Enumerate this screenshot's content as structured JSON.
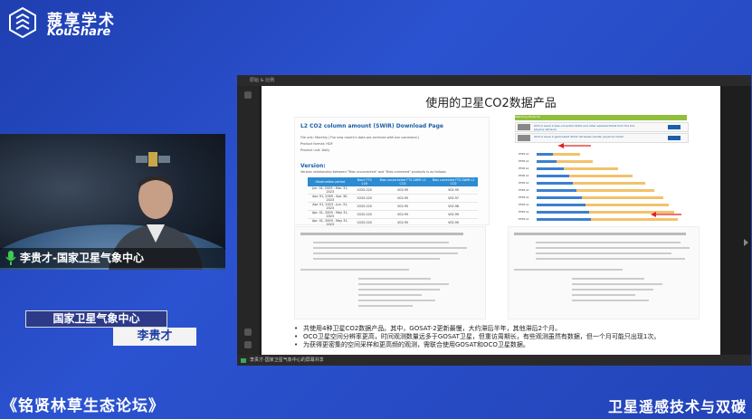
{
  "brand": {
    "name_cn": "蔻享学术",
    "name_en": "KouShare"
  },
  "speaker": {
    "caption": "李贵才-国家卫星气象中心",
    "org": "国家卫星气象中心",
    "name": "李贵才"
  },
  "screen_share": {
    "topbar": "原始 & 比例",
    "bottombar": "李贵才-国家卫星气象中心的屏幕共享"
  },
  "slide": {
    "title": "使用的卫星CO2数据产品",
    "panel_left": {
      "title": "L2 CO2 column amount (SWIR) Download Page",
      "lines": [
        "File unit: Monthly (The new month's data are archived with bar command.)",
        "Product format: HDF",
        "Product unit: Daily"
      ],
      "version_label": "Version:",
      "version_note": "Version relationship between \"Bias uncorrected\" and \"Bias corrected\" products is as follows.",
      "table": {
        "headers": [
          "Observation period",
          "Band TTS L1B",
          "Bias uncorrected FTS-SWIR L2 CO2",
          "Bias corrected FTS-SWIR L2 CO2"
        ],
        "rows": [
          [
            "Jun. 01, 2009 - Mar. 31, 2023",
            "V220.220",
            "V02.95",
            "V02.95"
          ],
          [
            "Apr. 01, 2009 - Apr. 30, 2023",
            "V220.220",
            "V02.95",
            "V02.97"
          ],
          [
            "Apr. 01, 2023 - Jun. 31, 2023",
            "V220.220",
            "V02.95",
            "V02.98"
          ],
          [
            "Apr. 01, 2009 - May 31, 2023",
            "V220.220",
            "V02.95",
            "V02.99"
          ],
          [
            "Apr. 01, 2009 - May 31, 2023",
            "V220.220",
            "V02.95",
            "V02.90"
          ]
        ]
      }
    },
    "panel_right": {
      "header": "Matching Products",
      "rows": [
        "OCO-2 Level 2 bias-corrected XCO2 and other selected fields from the full-physics retrieval",
        "OCO-2 Level 2 geolocated XCO2 retrievals results, physical model"
      ],
      "bar_labels": [
        "P708 L2",
        "P708 L2",
        "P708 L2",
        "P708 L2",
        "P708 L2",
        "P708 L2",
        "P708 L2",
        "P708 L2",
        "P708 L2",
        "P708 L2"
      ]
    },
    "bullets": [
      "共使用4种卫星CO2数据产品。其中，GOSAT-2更新最慢，大约滞后半年，其他滞后2个月。",
      "OCO卫星空间分辨率更高，时间观测数量远多于GOSAT卫星，但重访周期长，有些观测虽然有数据，但一个月可能只出现1次。",
      "为获得更密集的空间采样和更高频的观测，需联合使用GOSAT和OCO卫星数据。"
    ]
  },
  "footer": {
    "left": "《铭贤林草生态论坛》",
    "right": "卫星遥感技术与双碳"
  },
  "colors": {
    "background": "#2b52d0",
    "accent": "#1e3ea2",
    "table_header": "#2c8bd1"
  }
}
